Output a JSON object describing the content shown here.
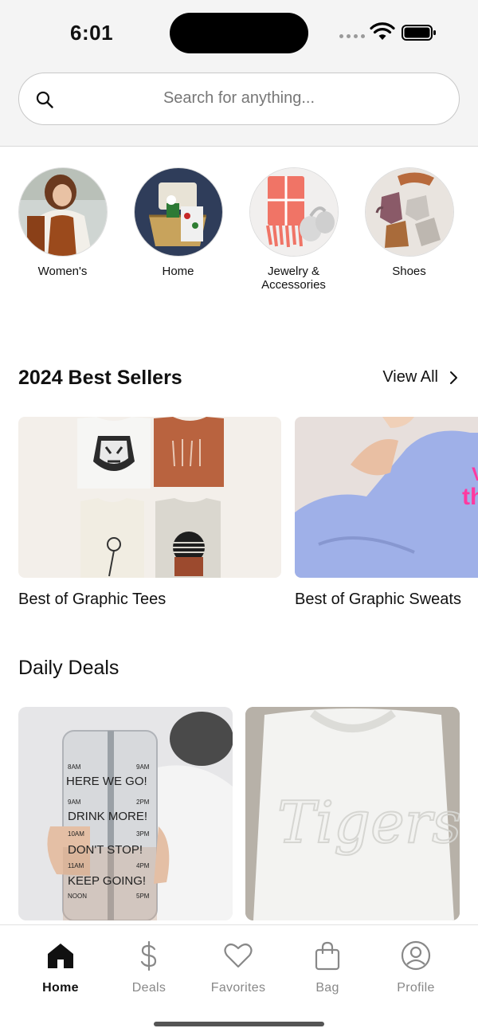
{
  "status_bar": {
    "time": "6:01"
  },
  "search": {
    "placeholder": "Search for anything..."
  },
  "categories": [
    {
      "label": "Women's",
      "image_name": "womens-category-image"
    },
    {
      "label": "Home",
      "image_name": "home-category-image"
    },
    {
      "label": "Jewelry &\nAccessories",
      "image_name": "jewelry-category-image"
    },
    {
      "label": "Shoes",
      "image_name": "shoes-category-image"
    }
  ],
  "best_sellers": {
    "title": "2024 Best Sellers",
    "view_all": "View All",
    "items": [
      {
        "label": "Best of Graphic Tees"
      },
      {
        "label": "Best of Graphic Sweats"
      }
    ]
  },
  "daily_deals": {
    "title": "Daily Deals",
    "water_bottle_text": [
      "8AM",
      "9AM",
      "HERE WE GO!",
      "9AM",
      "2PM",
      "DRINK MORE!",
      "10AM",
      "3PM",
      "DON'T STOP!",
      "11AM",
      "4PM",
      "KEEP GOING!",
      "NOON",
      "5PM"
    ],
    "sweatshirt_text": "Tigers"
  },
  "tab_bar": {
    "tabs": [
      {
        "label": "Home",
        "icon": "home-icon",
        "active": true
      },
      {
        "label": "Deals",
        "icon": "dollar-icon",
        "active": false
      },
      {
        "label": "Favorites",
        "icon": "heart-icon",
        "active": false
      },
      {
        "label": "Bag",
        "icon": "bag-icon",
        "active": false
      },
      {
        "label": "Profile",
        "icon": "profile-icon",
        "active": false
      }
    ]
  },
  "colors": {
    "accent": "#111111",
    "inactive": "#888888",
    "header_bg": "#f4f4f4",
    "sweat_blue": "#9fb0e8",
    "pink_text": "#ff3aa0"
  }
}
